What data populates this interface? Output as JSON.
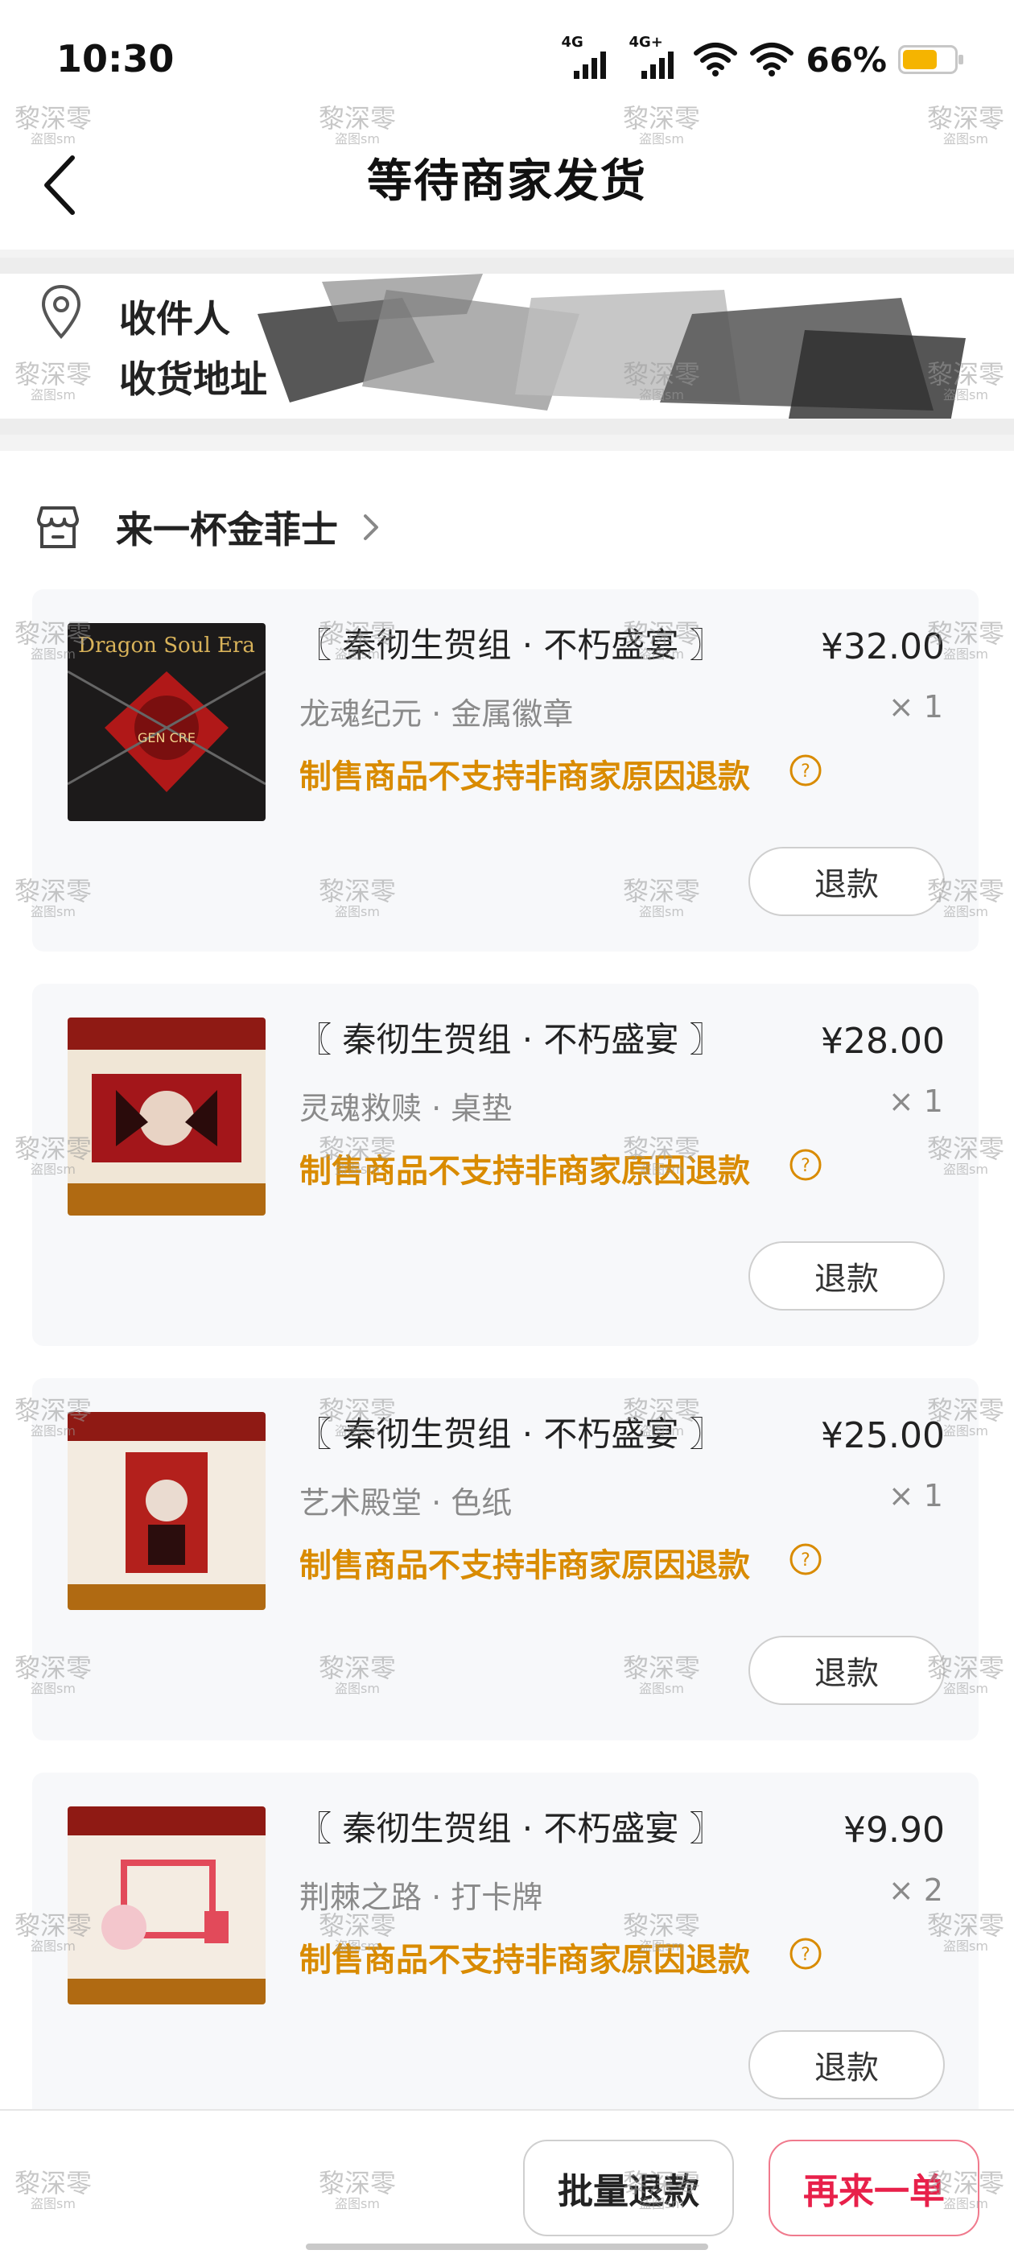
{
  "status_bar": {
    "time": "10:30",
    "signal_1": "4G",
    "signal_2": "4G+",
    "battery": "66%"
  },
  "header": {
    "title": "等待商家发货"
  },
  "address": {
    "recipient_label": "收件人",
    "address_label": "收货地址"
  },
  "store": {
    "name": "来一杯金菲士"
  },
  "items": [
    {
      "title": "〖 秦彻生贺组 · 不朽盛宴 〗",
      "price": "¥32.00",
      "variant": "龙魂纪元 · 金属徽章",
      "qty": "× 1",
      "notice": "制售商品不支持非商家原因退款",
      "refund_label": "退款",
      "thumb_text": "Dragon Soul Era",
      "thumb_text_2": "GEN CRE"
    },
    {
      "title": "〖 秦彻生贺组 · 不朽盛宴 〗",
      "price": "¥28.00",
      "variant": "灵魂救赎 · 桌垫",
      "qty": "× 1",
      "notice": "制售商品不支持非商家原因退款",
      "refund_label": "退款"
    },
    {
      "title": "〖 秦彻生贺组 · 不朽盛宴 〗",
      "price": "¥25.00",
      "variant": "艺术殿堂 · 色纸",
      "qty": "× 1",
      "notice": "制售商品不支持非商家原因退款",
      "refund_label": "退款"
    },
    {
      "title": "〖 秦彻生贺组 · 不朽盛宴 〗",
      "price": "¥9.90",
      "variant": "荆棘之路 · 打卡牌",
      "qty": "× 2",
      "notice": "制售商品不支持非商家原因退款",
      "refund_label": "退款"
    }
  ],
  "bottom_bar": {
    "bulk_refund": "批量退款",
    "reorder": "再来一单"
  },
  "watermark": {
    "main": "黎深零",
    "sub": "盗图sm"
  },
  "colors": {
    "notice": "#d98b00",
    "reorder": "#e8204a",
    "battery": "#f5b400"
  },
  "icons": [
    "back-arrow-icon",
    "location-pin-icon",
    "store-icon",
    "chevron-right-icon",
    "help-circle-icon",
    "wifi-icon",
    "signal-icon",
    "battery-icon"
  ]
}
